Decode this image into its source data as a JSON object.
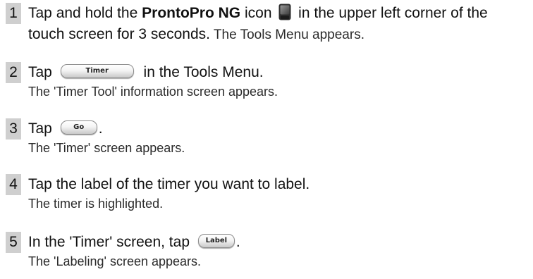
{
  "steps": [
    {
      "number": "1",
      "pre": "Tap and hold the ",
      "bold": "ProntoPro NG",
      "mid": " icon ",
      "post": " in the upper left corner of the",
      "line2_main": "touch screen for 3 seconds.",
      "line2_sub": " The Tools Menu appears.",
      "icon": "device-icon"
    },
    {
      "number": "2",
      "pre": "Tap ",
      "button": "Timer",
      "post": " in the Tools Menu.",
      "sub": "The 'Timer Tool' information screen appears."
    },
    {
      "number": "3",
      "pre": "Tap ",
      "button": "Go",
      "post": ".",
      "sub": "The 'Timer' screen appears."
    },
    {
      "number": "4",
      "text": "Tap the label of the timer you want to label.",
      "sub": "The timer is highlighted."
    },
    {
      "number": "5",
      "pre": "In the 'Timer' screen, tap ",
      "button": "Label",
      "post": ".",
      "sub": "The 'Labeling' screen appears."
    }
  ]
}
